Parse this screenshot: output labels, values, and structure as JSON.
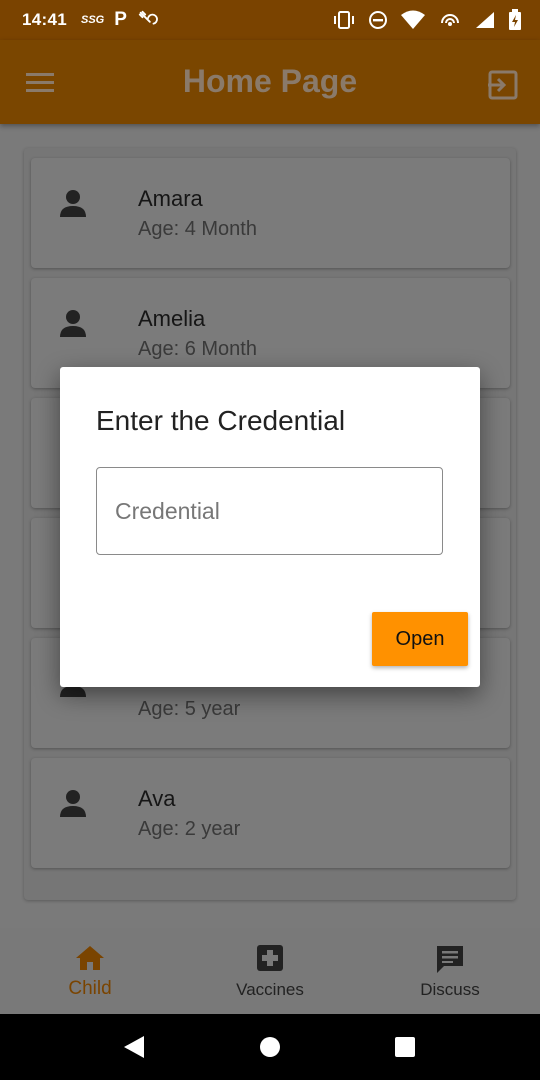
{
  "status_bar": {
    "time": "14:41",
    "carrier_badge": "SSG",
    "parking_badge": "P",
    "icons": [
      "sgg-icon",
      "parking-icon",
      "bug-icon",
      "vibrate-icon",
      "dnd-icon",
      "wifi-icon",
      "hotspot-icon",
      "signal-icon",
      "battery-icon"
    ]
  },
  "app_bar": {
    "title": "Home Page",
    "menu_icon": "menu-icon",
    "logout_icon": "logout-icon"
  },
  "children": [
    {
      "name": "Amara",
      "age": "Age: 4 Month"
    },
    {
      "name": "Amelia",
      "age": "Age: 6 Month"
    },
    {
      "name": "",
      "age": ""
    },
    {
      "name": "",
      "age": ""
    },
    {
      "name": "",
      "age": "Age: 5 year"
    },
    {
      "name": "Ava",
      "age": "Age: 2 year"
    }
  ],
  "bottom_nav": [
    {
      "label": "Child",
      "icon": "home-icon",
      "active": true
    },
    {
      "label": "Vaccines",
      "icon": "medical-plus-icon",
      "active": false
    },
    {
      "label": "Discuss",
      "icon": "chat-icon",
      "active": false
    }
  ],
  "dialog": {
    "title": "Enter the Credential",
    "input_placeholder": "Credential",
    "input_value": "",
    "open_label": "Open"
  },
  "colors": {
    "app_bar": "#7a4600",
    "accent": "#ff9100",
    "active_nav": "#7a4400"
  }
}
